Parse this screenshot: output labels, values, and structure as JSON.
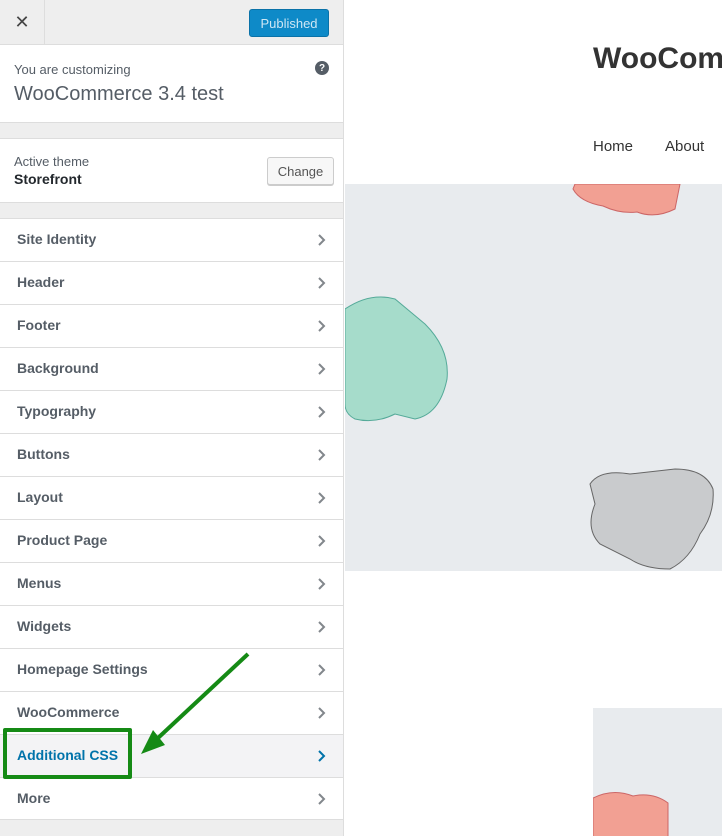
{
  "topbar": {
    "close_label": "✕",
    "publish_label": "Published"
  },
  "info": {
    "label": "You are customizing",
    "title": "WooCommerce 3.4 test",
    "help_icon": "?"
  },
  "theme": {
    "label": "Active theme",
    "name": "Storefront",
    "change_label": "Change"
  },
  "menu": {
    "items": [
      {
        "label": "Site Identity"
      },
      {
        "label": "Header"
      },
      {
        "label": "Footer"
      },
      {
        "label": "Background"
      },
      {
        "label": "Typography"
      },
      {
        "label": "Buttons"
      },
      {
        "label": "Layout"
      },
      {
        "label": "Product Page"
      },
      {
        "label": "Menus"
      },
      {
        "label": "Widgets"
      },
      {
        "label": "Homepage Settings"
      },
      {
        "label": "WooCommerce"
      },
      {
        "label": "Additional CSS",
        "active": true
      },
      {
        "label": "More"
      }
    ]
  },
  "preview": {
    "site_title": "WooComm",
    "nav": [
      "Home",
      "About"
    ]
  },
  "colors": {
    "accent": "#0073aa",
    "publish": "#0e8ac8",
    "annotation": "#158a15"
  }
}
